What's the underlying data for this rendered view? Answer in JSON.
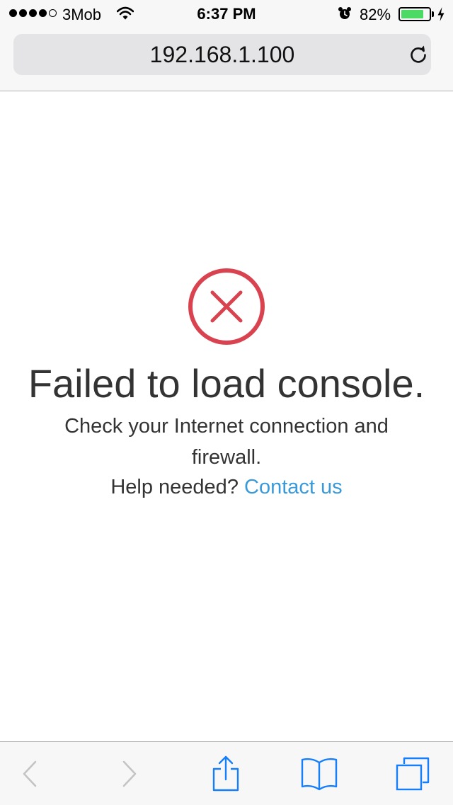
{
  "status_bar": {
    "signal_bars_filled": 4,
    "signal_bars_total": 5,
    "carrier": "3Mob",
    "time": "6:37 PM",
    "battery_percent": "82%",
    "battery_level": 0.82,
    "icons": [
      "signal-icon",
      "wifi-icon",
      "alarm-icon",
      "battery-icon",
      "charging-bolt-icon"
    ]
  },
  "address_bar": {
    "url": "192.168.1.100",
    "reload_icon": "reload-icon"
  },
  "error": {
    "icon": "error-x-circle-icon",
    "icon_color": "#d9434f",
    "title": "Failed to load console.",
    "message": "Check your Internet connection and firewall.",
    "help_prefix": "Help needed?",
    "help_link": "Contact us",
    "link_color": "#3a9ad9"
  },
  "toolbar": {
    "back_icon": "chevron-left-icon",
    "forward_icon": "chevron-right-icon",
    "share_icon": "share-icon",
    "bookmarks_icon": "bookmarks-icon",
    "tabs_icon": "tabs-icon",
    "accent_color": "#157efb"
  }
}
